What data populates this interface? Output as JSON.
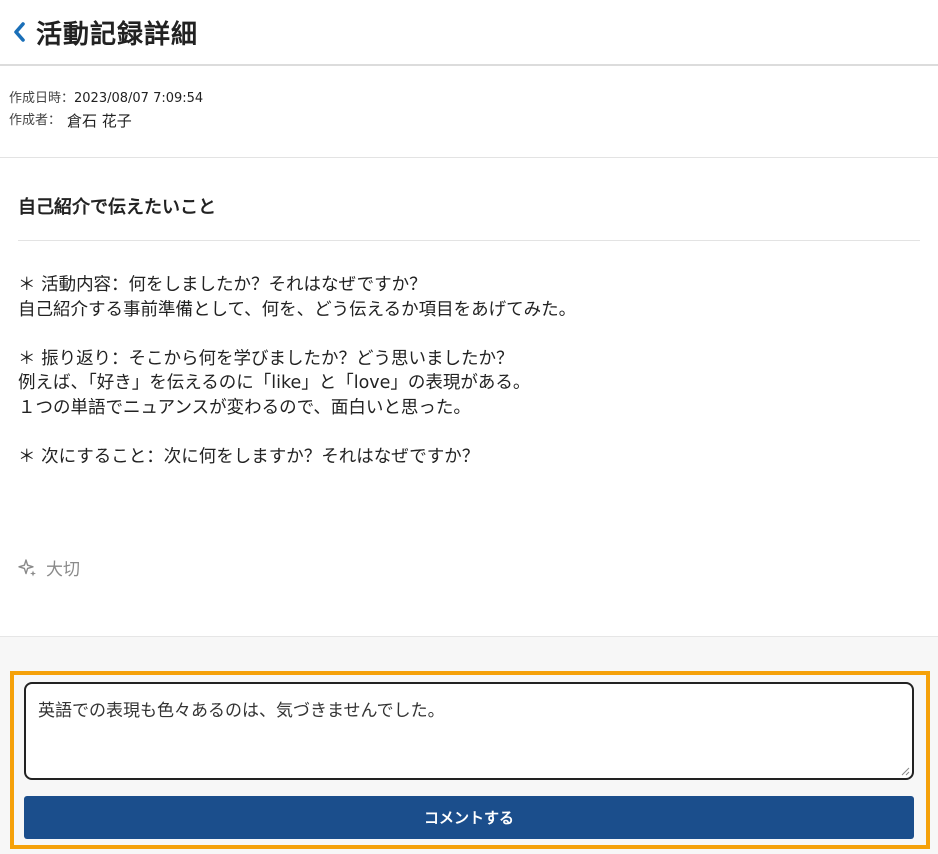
{
  "header": {
    "back_icon": "chevron-left-icon",
    "title": "活動記録詳細",
    "accent_color": "#1a6fb8"
  },
  "meta": {
    "created_at_label": "作成日時：",
    "created_at_value": "2023/08/07 7:09:54",
    "author_label": "作成者：",
    "author_value": "倉石 花子"
  },
  "post": {
    "title": "自己紹介で伝えたいこと",
    "body": [
      "＊ 活動内容：何をしましたか？それはなぜですか？",
      "自己紹介する事前準備として、何を、どう伝えるか項目をあげてみた。",
      "",
      "＊ 振り返り：そこから何を学びましたか？どう思いましたか？",
      "例えば、「好き」を伝えるのに「like」と「love」の表現がある。",
      "１つの単語でニュアンスが変わるので、面白いと思った。",
      "",
      "＊ 次にすること：次に何をしますか？それはなぜですか？"
    ]
  },
  "important": {
    "icon": "sparkle-icon",
    "label": "大切"
  },
  "comment": {
    "input_value": "英語での表現も色々あるのは、気づきませんでした。",
    "submit_label": "コメントする",
    "submit_color": "#1b4e8c",
    "highlight_color": "#f5a10a"
  }
}
